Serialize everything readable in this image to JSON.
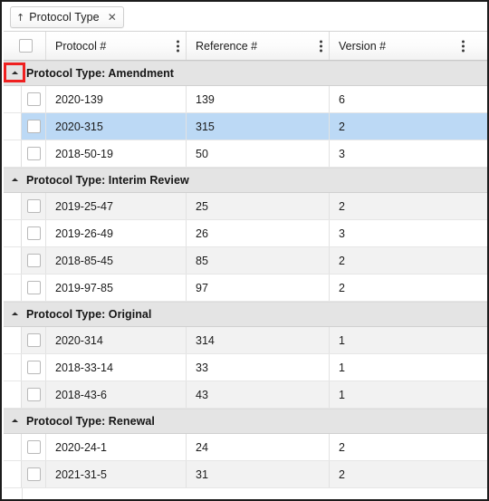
{
  "window": {
    "border_color": "#1c1c1c",
    "background": "#ffffff"
  },
  "groupby_bar": {
    "chips": [
      {
        "sort_icon": "↑",
        "label": "Protocol Type",
        "close_icon": "✕"
      }
    ]
  },
  "grid": {
    "select_all_checkbox": "",
    "columns": [
      {
        "label": "Protocol #",
        "menu_icon": "kebab-icon"
      },
      {
        "label": "Reference #",
        "menu_icon": "kebab-icon"
      },
      {
        "label": "Version #",
        "menu_icon": "kebab-icon"
      }
    ],
    "groups": [
      {
        "label": "Protocol Type: Amendment",
        "expanded": true,
        "toggle_icon": "collapse-triangle",
        "rows": [
          {
            "protocol": "2020-139",
            "reference": "139",
            "version": "6",
            "selected": false
          },
          {
            "protocol": "2020-315",
            "reference": "315",
            "version": "2",
            "selected": true
          },
          {
            "protocol": "2018-50-19",
            "reference": "50",
            "version": "3",
            "selected": false
          }
        ]
      },
      {
        "label": "Protocol Type: Interim Review",
        "expanded": true,
        "toggle_icon": "collapse-triangle",
        "rows": [
          {
            "protocol": "2019-25-47",
            "reference": "25",
            "version": "2",
            "selected": false
          },
          {
            "protocol": "2019-26-49",
            "reference": "26",
            "version": "3",
            "selected": false
          },
          {
            "protocol": "2018-85-45",
            "reference": "85",
            "version": "2",
            "selected": false
          },
          {
            "protocol": "2019-97-85",
            "reference": "97",
            "version": "2",
            "selected": false
          }
        ]
      },
      {
        "label": "Protocol Type: Original",
        "expanded": true,
        "toggle_icon": "collapse-triangle",
        "rows": [
          {
            "protocol": "2020-314",
            "reference": "314",
            "version": "1",
            "selected": false
          },
          {
            "protocol": "2018-33-14",
            "reference": "33",
            "version": "1",
            "selected": false
          },
          {
            "protocol": "2018-43-6",
            "reference": "43",
            "version": "1",
            "selected": false
          }
        ]
      },
      {
        "label": "Protocol Type: Renewal",
        "expanded": true,
        "toggle_icon": "collapse-triangle",
        "rows": [
          {
            "protocol": "2020-24-1",
            "reference": "24",
            "version": "2",
            "selected": false
          },
          {
            "protocol": "2021-31-5",
            "reference": "31",
            "version": "2",
            "selected": false
          }
        ]
      }
    ]
  },
  "annotation": {
    "color": "#ef2020",
    "target": "first-group-collapse-toggle"
  }
}
